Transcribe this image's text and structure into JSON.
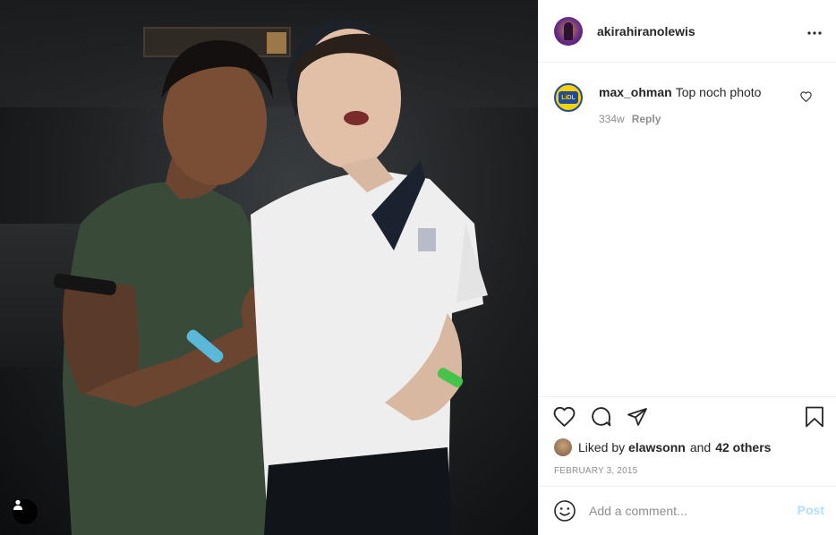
{
  "post": {
    "username": "akirahiranolewis",
    "more_icon": "more-horizontal-icon"
  },
  "comments": [
    {
      "username": "max_ohman",
      "text": "Top noch photo",
      "age": "334w",
      "reply_label": "Reply",
      "avatar_logo_text": "LiDL"
    }
  ],
  "likes": {
    "prefix": "Liked by",
    "first_user": "elawsonn",
    "and": "and",
    "others": "42 others"
  },
  "date": "FEBRUARY 3, 2015",
  "composer": {
    "placeholder": "Add a comment...",
    "post_label": "Post"
  },
  "icons": {
    "like": "heart-icon",
    "comment": "comment-icon",
    "share": "share-icon",
    "save": "bookmark-icon",
    "emoji": "emoji-icon",
    "user_tags": "user-icon"
  },
  "colors": {
    "text": "#262626",
    "muted": "#8e8e8e",
    "post_disabled": "#b2dffc",
    "border": "#efefef"
  }
}
